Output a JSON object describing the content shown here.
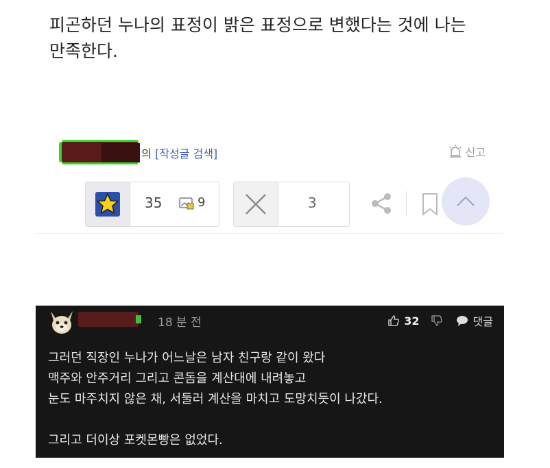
{
  "post": {
    "body_line1": "피곤하던 누나의 표정이 밝은 표정으로 변했다는 것에 나는",
    "body_line2": "만족한다."
  },
  "author": {
    "suffix": "의",
    "search_link": "[작성글 검색]",
    "report_label": "신고"
  },
  "actions": {
    "recommend_count": "35",
    "image_count": "9",
    "not_recommend_count": "3"
  },
  "comment": {
    "time": "18 분 전",
    "likes": "32",
    "reply_label": "댓글",
    "lines": [
      "그러던 직장인 누나가 어느날은 남자 친구랑 같이 왔다",
      "맥주와 안주거리 그리고 콘돔을 계산대에 내려놓고",
      "눈도 마주치지 않은 채, 서둘러 계산을 마치고 도망치듯이 나갔다."
    ],
    "last_line": "그리고 더이상 포켓몬빵은 없었다."
  },
  "icons": {
    "star": "star-icon",
    "image": "image-icon",
    "close": "x-icon",
    "share": "share-icon",
    "bookmark": "bookmark-icon",
    "scroll_top": "chevron-up-icon",
    "report": "siren-icon",
    "thumbs_up": "thumbs-up-icon",
    "thumbs_down": "thumbs-down-icon",
    "reply": "speech-bubble-icon"
  },
  "colors": {
    "link": "#3b5bb5",
    "star_fill": "#f5d21e",
    "star_bg": "#2d4fa8",
    "comment_bg": "#161616",
    "scroll_top_bg": "#e4e6f7"
  }
}
